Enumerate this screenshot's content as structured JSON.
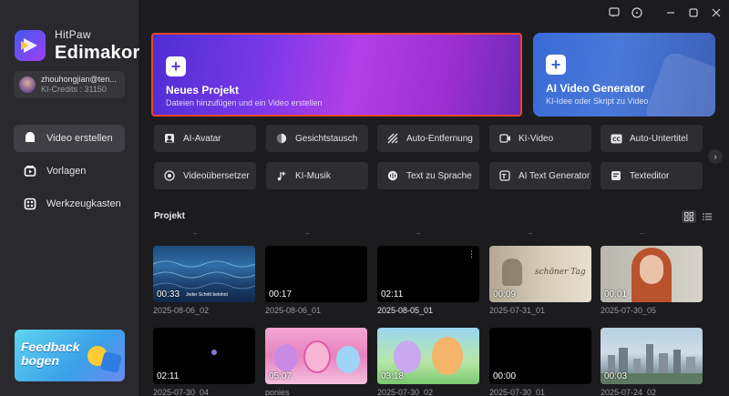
{
  "brand": {
    "small": "HitPaw",
    "big": "Edimakor"
  },
  "account": {
    "name": "zhouhongjian@ten...",
    "credits": "KI-Credits : 31150"
  },
  "nav": [
    {
      "label": "Video erstellen",
      "icon": "video-create-icon",
      "active": true
    },
    {
      "label": "Vorlagen",
      "icon": "templates-icon",
      "active": false
    },
    {
      "label": "Werkzeugkasten",
      "icon": "toolbox-icon",
      "active": false
    }
  ],
  "feedback": {
    "line1": "Feedback",
    "line2": "bogen"
  },
  "hero": {
    "new_project": {
      "title": "Neues Projekt",
      "subtitle": "Dateien hinzufügen und ein Video erstellen"
    },
    "ai_video": {
      "title": "AI Video Generator",
      "subtitle": "KI-Idee oder Skript zu Video"
    }
  },
  "tools": [
    {
      "label": "AI-Avatar",
      "icon": "avatar-icon"
    },
    {
      "label": "Gesichtstausch",
      "icon": "face-swap-icon"
    },
    {
      "label": "Auto-Entfernung",
      "icon": "auto-remove-icon"
    },
    {
      "label": "KI-Video",
      "icon": "ai-video-icon"
    },
    {
      "label": "Auto-Untertitel",
      "icon": "subtitle-icon"
    },
    {
      "label": "Videoübersetzer",
      "icon": "translator-icon"
    },
    {
      "label": "KI-Musik",
      "icon": "music-icon"
    },
    {
      "label": "Text zu Sprache",
      "icon": "tts-icon"
    },
    {
      "label": "AI Text Generator",
      "icon": "text-generator-icon"
    },
    {
      "label": "Texteditor",
      "icon": "text-editor-icon"
    }
  ],
  "projects_title": "Projekt",
  "projects": [
    {
      "duration": "00:33",
      "name": "2025-08-06_02",
      "caption": "Jeder Schritt belohnt",
      "thumb": "ocean"
    },
    {
      "duration": "00:17",
      "name": "2025-08-06_01",
      "thumb": "black"
    },
    {
      "duration": "02:11",
      "name": "2025-08-05_01",
      "thumb": "black",
      "highlight": true
    },
    {
      "duration": "00:09",
      "name": "2025-07-31_01",
      "caption": "schöner Tag",
      "thumb": "sepia"
    },
    {
      "duration": "00:01",
      "name": "2025-07-30_05",
      "thumb": "portrait"
    },
    {
      "duration": "02:11",
      "name": "2025-07-30_04",
      "thumb": "dark-dot"
    },
    {
      "duration": "05:07",
      "name": "ponies",
      "thumb": "ponies-pink"
    },
    {
      "duration": "03:18",
      "name": "2025-07-30_02",
      "thumb": "ponies-green"
    },
    {
      "duration": "00:00",
      "name": "2025-07-30_01",
      "thumb": "black"
    },
    {
      "duration": "00:03",
      "name": "2025-07-24_02",
      "thumb": "city"
    }
  ]
}
